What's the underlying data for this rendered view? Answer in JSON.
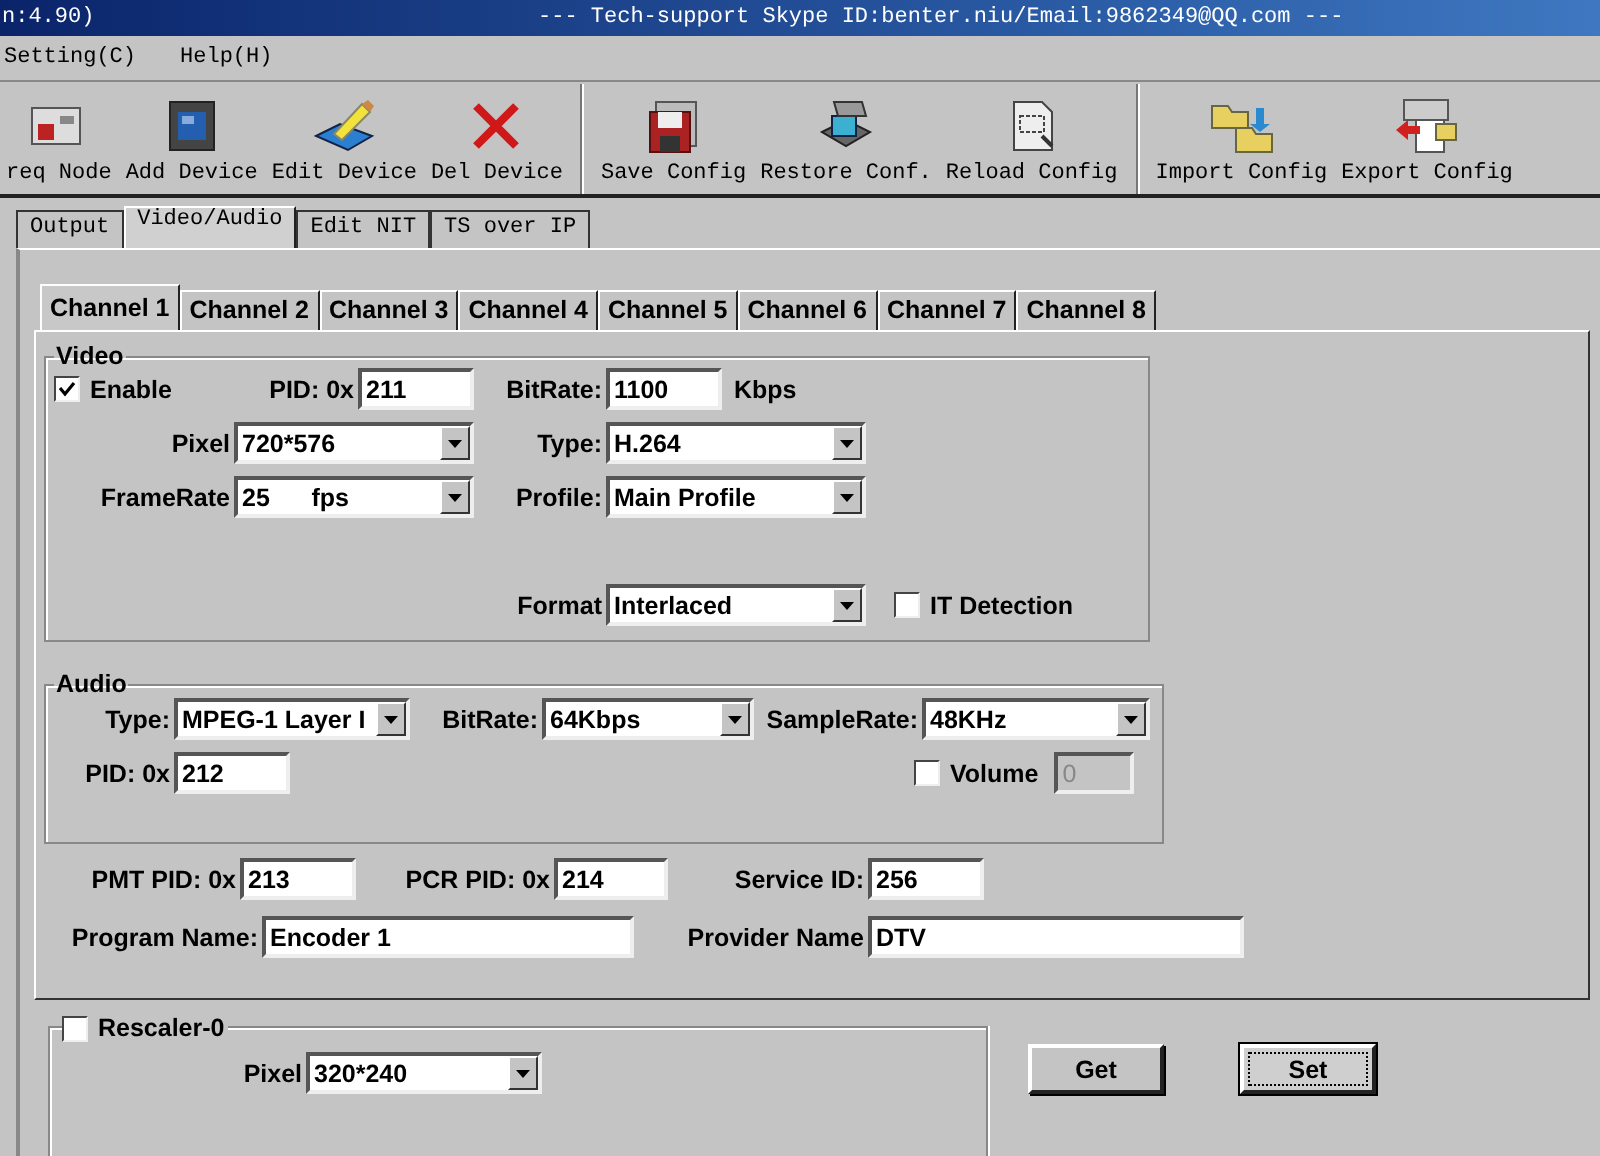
{
  "window": {
    "title_left": "n:4.90)",
    "title": "--- Tech-support Skype ID:benter.niu/Email:9862349@QQ.com ---"
  },
  "menu": [
    "Setting(C)",
    "Help(H)"
  ],
  "toolbar": [
    [
      {
        "label": "req Node",
        "kind": "node"
      },
      {
        "label": "Add Device",
        "kind": "add"
      },
      {
        "label": "Edit Device",
        "kind": "edit"
      },
      {
        "label": "Del Device",
        "kind": "delete"
      }
    ],
    [
      {
        "label": "Save Config",
        "kind": "save"
      },
      {
        "label": "Restore Conf.",
        "kind": "restore"
      },
      {
        "label": "Reload Config",
        "kind": "reload"
      }
    ],
    [
      {
        "label": "Import Config",
        "kind": "import"
      },
      {
        "label": "Export Config",
        "kind": "export"
      }
    ]
  ],
  "tabs": [
    {
      "label": "Output",
      "selected": false
    },
    {
      "label": "Video/Audio",
      "selected": true
    },
    {
      "label": "Edit NIT",
      "selected": false
    },
    {
      "label": "TS over IP",
      "selected": false
    }
  ],
  "channel_tabs": [
    {
      "label": "Channel 1",
      "selected": true
    },
    {
      "label": "Channel 2",
      "selected": false
    },
    {
      "label": "Channel 3",
      "selected": false
    },
    {
      "label": "Channel 4",
      "selected": false
    },
    {
      "label": "Channel 5",
      "selected": false
    },
    {
      "label": "Channel 6",
      "selected": false
    },
    {
      "label": "Channel 7",
      "selected": false
    },
    {
      "label": "Channel 8",
      "selected": false
    }
  ],
  "video": {
    "title": "Video",
    "enable": {
      "label": "Enable",
      "checked": true
    },
    "pid_label": "PID: 0x",
    "pid": "211",
    "bitrate_label": "BitRate:",
    "bitrate": "1100",
    "bitrate_unit": "Kbps",
    "pixel_label": "Pixel",
    "pixel": "720*576",
    "type_label": "Type:",
    "type": "H.264",
    "framerate_label": "FrameRate",
    "framerate": "25      fps",
    "profile_label": "Profile:",
    "profile": "Main Profile",
    "format_label": "Format",
    "format": "Interlaced",
    "it_detection": {
      "label": "IT Detection",
      "checked": false
    }
  },
  "audio": {
    "title": "Audio",
    "type_label": "Type:",
    "type": "MPEG-1 Layer I",
    "bitrate_label": "BitRate:",
    "bitrate": "64Kbps",
    "samplerate_label": "SampleRate:",
    "samplerate": "48KHz",
    "pid_label": "PID: 0x",
    "pid": "212",
    "volume": {
      "label": "Volume",
      "checked": false,
      "value": "0",
      "disabled": true
    }
  },
  "stream": {
    "pmt_label": "PMT PID: 0x",
    "pmt": "213",
    "pcr_label": "PCR PID: 0x",
    "pcr": "214",
    "service_label": "Service ID:",
    "service": "256",
    "program_label": "Program Name:",
    "program": "Encoder 1",
    "provider_label": "Provider Name",
    "provider": "DTV"
  },
  "rescaler": {
    "label": "Rescaler-0",
    "checked": false,
    "pixel_label": "Pixel",
    "pixel": "320*240"
  },
  "buttons": [
    {
      "label": "Get",
      "focused": false
    },
    {
      "label": "Set",
      "focused": true
    }
  ]
}
